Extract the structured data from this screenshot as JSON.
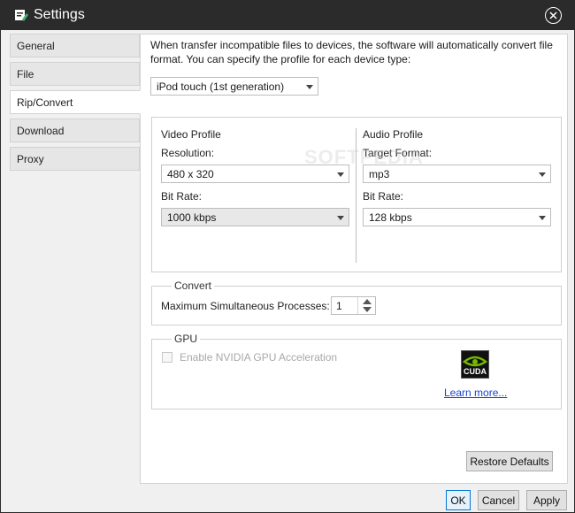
{
  "window": {
    "title": "Settings",
    "icon": "settings-pencil-icon",
    "titlebar_color": "#2b2b2b",
    "accent_green": "#3db36b"
  },
  "sidebar": {
    "items": [
      {
        "label": "General",
        "active": false
      },
      {
        "label": "File",
        "active": false
      },
      {
        "label": "Rip/Convert",
        "active": true
      },
      {
        "label": "Download",
        "active": false
      },
      {
        "label": "Proxy",
        "active": false
      }
    ]
  },
  "content": {
    "description": "When transfer incompatible files to devices, the software will automatically convert file format. You can specify the profile for each device type:",
    "device_select": "iPod touch (1st generation)"
  },
  "video_profile": {
    "heading": "Video Profile",
    "resolution_label": "Resolution:",
    "resolution_value": "480 x 320",
    "bitrate_label": "Bit Rate:",
    "bitrate_value": "1000 kbps"
  },
  "audio_profile": {
    "heading": "Audio Profile",
    "format_label": "Target Format:",
    "format_value": "mp3",
    "bitrate_label": "Bit Rate:",
    "bitrate_value": "128 kbps"
  },
  "convert": {
    "legend": "Convert",
    "max_processes_label": "Maximum Simultaneous Processes:",
    "max_processes_value": "1"
  },
  "gpu": {
    "legend": "GPU",
    "enable_label": "Enable NVIDIA GPU Acceleration",
    "enabled": false,
    "logo_text": "CUDA",
    "learn_more": "Learn more..."
  },
  "watermark": "SOFTPEDIA",
  "buttons": {
    "restore_defaults": "Restore Defaults",
    "ok": "OK",
    "cancel": "Cancel",
    "apply": "Apply"
  }
}
